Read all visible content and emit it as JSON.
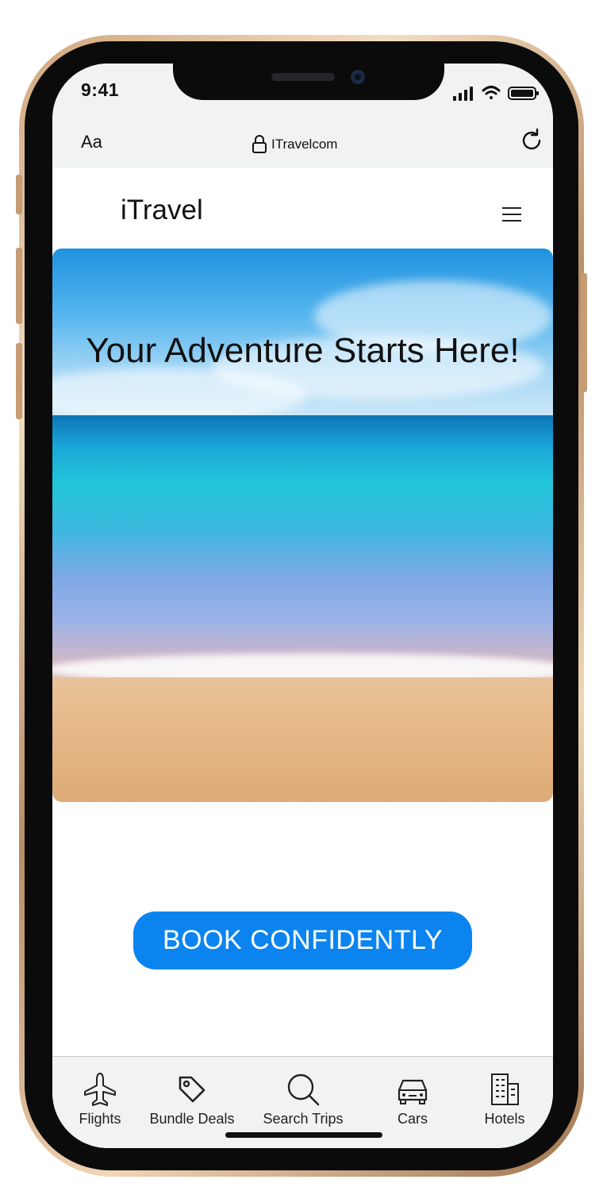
{
  "status_bar": {
    "time": "9:41"
  },
  "browser": {
    "text_size_label": "Aa",
    "url": "ITravelcom"
  },
  "site": {
    "brand": "iTravel"
  },
  "hero": {
    "headline": "Your Adventure Starts Here!"
  },
  "cta": {
    "label": "BOOK CONFIDENTLY",
    "color": "#0b84f0"
  },
  "tabbar": {
    "items": [
      {
        "label": "Flights",
        "icon": "airplane-icon"
      },
      {
        "label": "Bundle Deals",
        "icon": "tag-icon"
      },
      {
        "label": "Search Trips",
        "icon": "search-icon"
      },
      {
        "label": "Cars",
        "icon": "car-icon"
      },
      {
        "label": "Hotels",
        "icon": "building-icon"
      }
    ]
  }
}
